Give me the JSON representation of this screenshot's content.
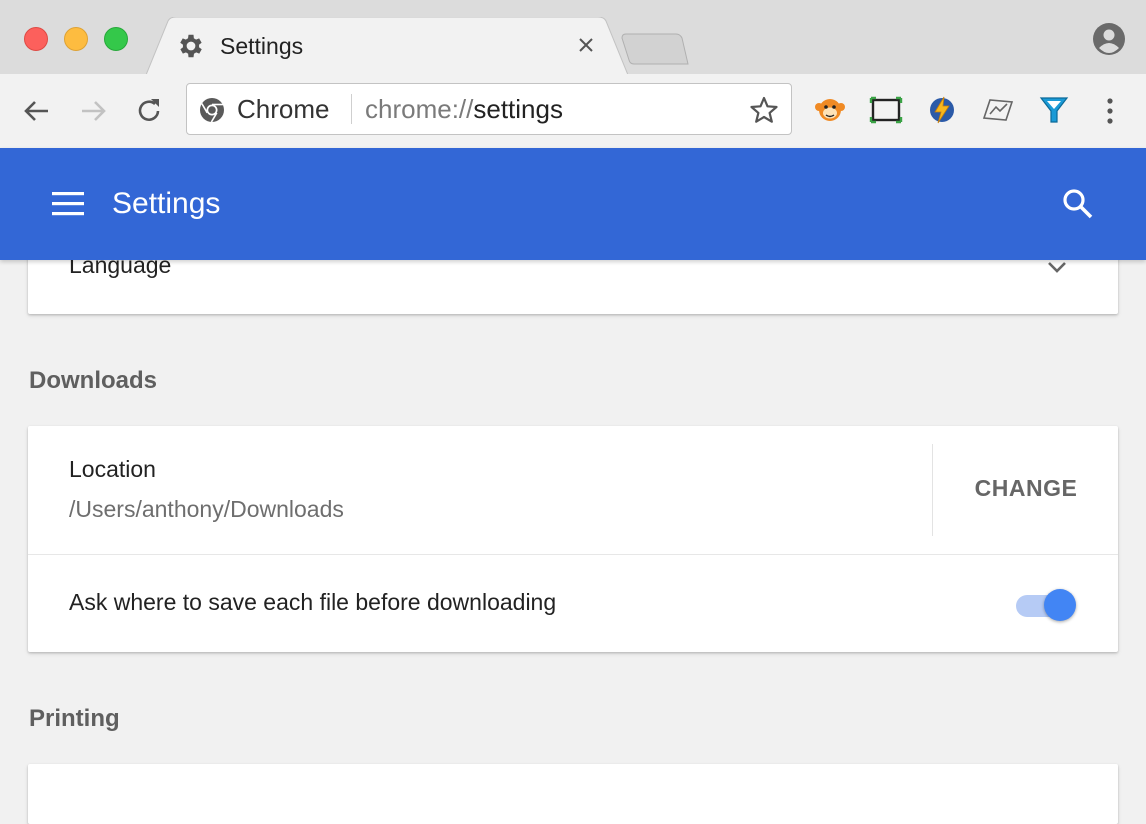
{
  "window": {
    "tab": {
      "title": "Settings",
      "icon": "gear-icon"
    }
  },
  "toolbar": {
    "site_chip": "Chrome",
    "url_scheme": "chrome://",
    "url_host": "settings",
    "extensions": [
      "monkey-extension-icon",
      "screen-capture-extension-icon",
      "lightning-extension-icon",
      "chart-extension-icon",
      "funnel-extension-icon"
    ]
  },
  "header": {
    "title": "Settings"
  },
  "sections": {
    "language": {
      "label": "Language"
    },
    "downloads": {
      "heading": "Downloads",
      "location_label": "Location",
      "location_path": "/Users/anthony/Downloads",
      "change_label": "CHANGE",
      "ask_label": "Ask where to save each file before downloading",
      "ask_enabled": true
    },
    "printing": {
      "heading": "Printing"
    }
  },
  "colors": {
    "header_bg": "#3367d6",
    "toggle_on": "#4285f4"
  }
}
